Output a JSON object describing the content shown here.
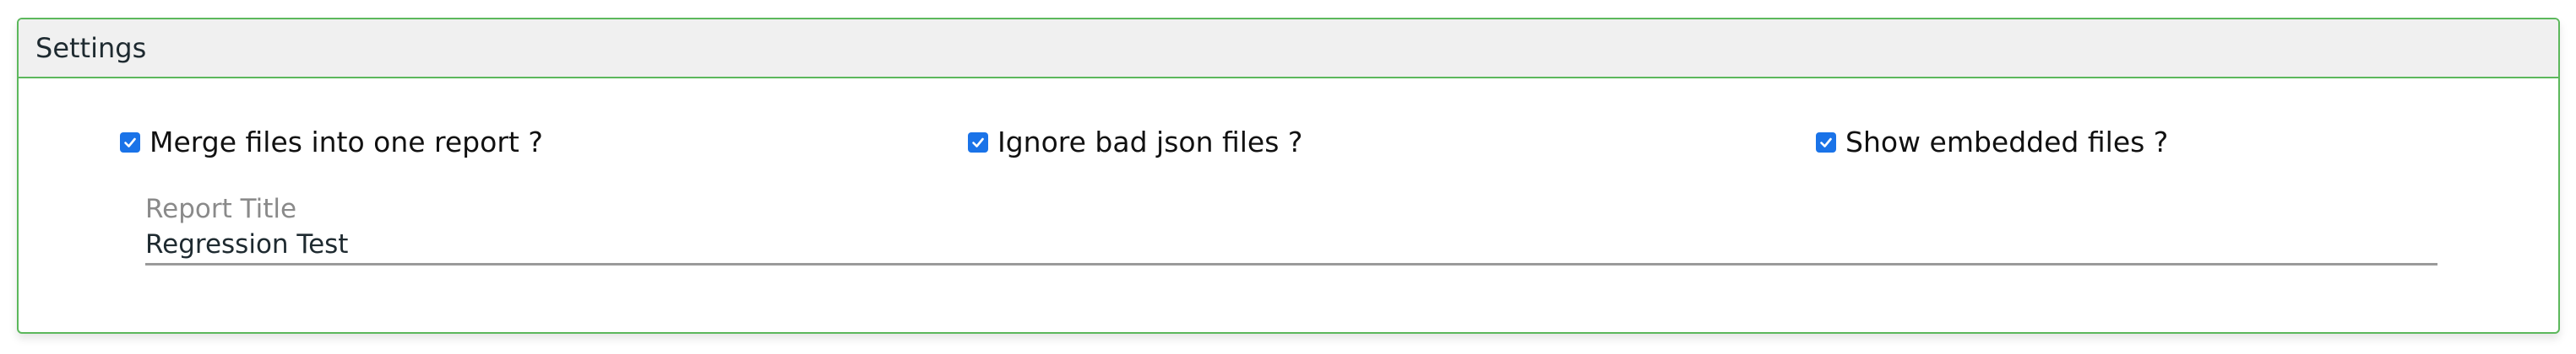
{
  "panel": {
    "title": "Settings"
  },
  "options": [
    {
      "label": "Merge files into one report ?",
      "checked": true
    },
    {
      "label": "Ignore bad json files ?",
      "checked": true
    },
    {
      "label": "Show embedded files ?",
      "checked": true
    }
  ],
  "report_title_field": {
    "label": "Report Title",
    "value": "Regression Test"
  },
  "colors": {
    "panel_border": "#5cb85c",
    "header_bg": "#f0f0f0",
    "checkbox_accent": "#1a73e8"
  }
}
